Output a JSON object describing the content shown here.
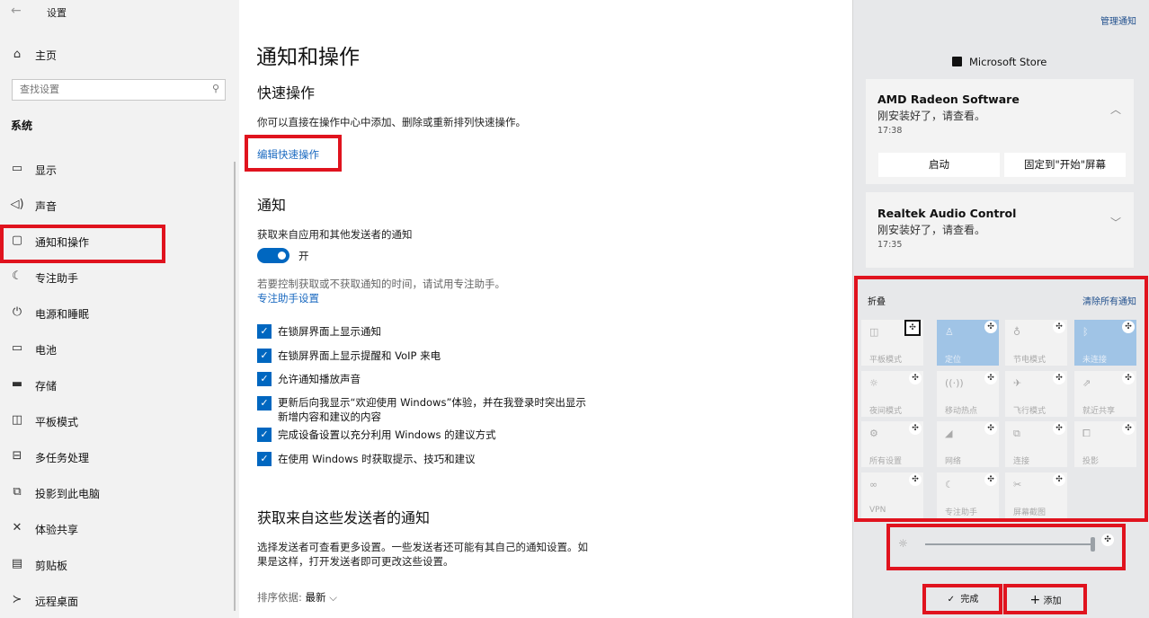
{
  "window": {
    "title": "设置"
  },
  "sidebar": {
    "home": "主页",
    "search_placeholder": "查找设置",
    "section": "系统",
    "items": [
      {
        "label": "显示",
        "icon": "monitor-icon"
      },
      {
        "label": "声音",
        "icon": "speaker-icon"
      },
      {
        "label": "通知和操作",
        "icon": "message-icon",
        "selected": true
      },
      {
        "label": "专注助手",
        "icon": "moon-icon"
      },
      {
        "label": "电源和睡眠",
        "icon": "power-icon"
      },
      {
        "label": "电池",
        "icon": "battery-icon"
      },
      {
        "label": "存储",
        "icon": "storage-icon"
      },
      {
        "label": "平板模式",
        "icon": "tablet-icon"
      },
      {
        "label": "多任务处理",
        "icon": "multitask-icon"
      },
      {
        "label": "投影到此电脑",
        "icon": "project-icon"
      },
      {
        "label": "体验共享",
        "icon": "share-icon"
      },
      {
        "label": "剪贴板",
        "icon": "clipboard-icon"
      },
      {
        "label": "远程桌面",
        "icon": "remote-icon"
      }
    ]
  },
  "main": {
    "title": "通知和操作",
    "quick": {
      "heading": "快速操作",
      "desc": "你可以直接在操作中心中添加、删除或重新排列快速操作。",
      "edit_link": "编辑快速操作"
    },
    "notify": {
      "heading": "通知",
      "get_label": "获取来自应用和其他发送者的通知",
      "toggle_state": "开",
      "toggle_on": true,
      "focus_hint": "若要控制获取或不获取通知的时间，请试用专注助手。",
      "focus_link": "专注助手设置",
      "checkboxes": [
        {
          "label": "在锁屏界面上显示通知",
          "checked": true
        },
        {
          "label": "在锁屏界面上显示提醒和 VoIP 来电",
          "checked": true
        },
        {
          "label": "允许通知播放声音",
          "checked": true
        },
        {
          "label": "更新后向我显示“欢迎使用 Windows”体验，并在我登录时突出显示",
          "label2": "新增内容和建议的内容",
          "checked": true
        },
        {
          "label": "完成设备设置以充分利用 Windows 的建议方式",
          "checked": true
        },
        {
          "label": "在使用 Windows 时获取提示、技巧和建议",
          "checked": true
        }
      ]
    },
    "senders": {
      "heading": "获取来自这些发送者的通知",
      "desc1": "选择发送者可查看更多设置。一些发送者还可能有其自己的通知设置。如",
      "desc2": "果是这样，打开发送者即可更改这些设置。",
      "sort_label": "排序依据:",
      "sort_value": "最新"
    }
  },
  "action_center": {
    "manage": "管理通知",
    "store_header": "Microsoft Store",
    "cards": [
      {
        "title": "AMD Radeon Software",
        "sub": "刚安装好了，请查看。",
        "time": "17:38",
        "btn1": "启动",
        "btn2": "固定到\"开始\"屏幕"
      },
      {
        "title": "Realtek Audio Control",
        "sub": "刚安装好了，请查看。",
        "time": "17:35"
      }
    ],
    "fold": "折叠",
    "clear_all": "清除所有通知",
    "tiles": [
      {
        "label": "平板模式",
        "icon": "tablet-icon",
        "on": false
      },
      {
        "label": "定位",
        "icon": "location-icon",
        "on": true
      },
      {
        "label": "节电模式",
        "icon": "battery-saver-icon",
        "on": false
      },
      {
        "label": "未连接",
        "icon": "bluetooth-icon",
        "on": true
      },
      {
        "label": "夜间模式",
        "icon": "night-light-icon",
        "on": false
      },
      {
        "label": "移动热点",
        "icon": "hotspot-icon",
        "on": false
      },
      {
        "label": "飞行模式",
        "icon": "airplane-icon",
        "on": false
      },
      {
        "label": "就近共享",
        "icon": "nearby-share-icon",
        "on": false
      },
      {
        "label": "所有设置",
        "icon": "gear-icon",
        "on": false
      },
      {
        "label": "网络",
        "icon": "network-icon",
        "on": false
      },
      {
        "label": "连接",
        "icon": "connect-icon",
        "on": false
      },
      {
        "label": "投影",
        "icon": "project-icon",
        "on": false
      },
      {
        "label": "VPN",
        "icon": "vpn-icon",
        "on": false
      },
      {
        "label": "专注助手",
        "icon": "moon-icon",
        "on": false
      },
      {
        "label": "屏幕截图",
        "icon": "screenshot-icon",
        "on": false
      }
    ],
    "brightness_level": 1.0,
    "done": "完成",
    "add": "添加"
  },
  "colors": {
    "accent": "#0067c0",
    "highlight": "#e0131e",
    "tile_on": "#a0c4e6"
  }
}
